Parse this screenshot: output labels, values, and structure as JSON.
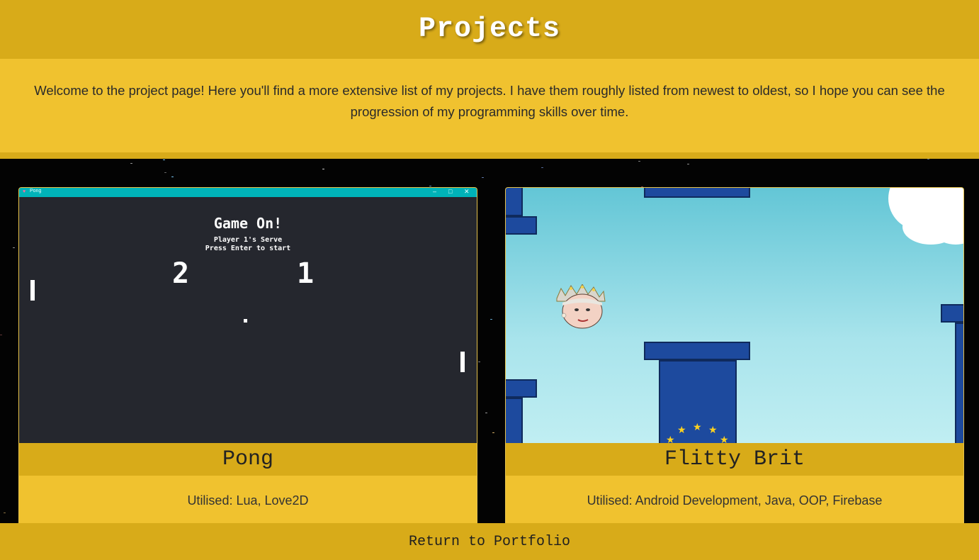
{
  "header": {
    "title": "Projects"
  },
  "intro": {
    "text": "Welcome to the project page! Here you'll find a more extensive list of my projects. I have them roughly listed from newest to oldest, so I hope you can see the progression of my programming skills over time."
  },
  "projects": [
    {
      "title": "Pong",
      "utilised": "Utilised: Lua, Love2D",
      "screenshot": {
        "window_title": "Pong",
        "headline": "Game On!",
        "serve_text": "Player 1's Serve",
        "prompt_text": "Press Enter to start",
        "score_left": "2",
        "score_right": "1"
      }
    },
    {
      "title": "Flitty Brit",
      "utilised": "Utilised: Android Development, Java, OOP, Firebase"
    }
  ],
  "footer": {
    "link_label": "Return to Portfolio"
  },
  "colors": {
    "header": "#d8ab19",
    "intro": "#f0c22f",
    "background": "#000000"
  }
}
